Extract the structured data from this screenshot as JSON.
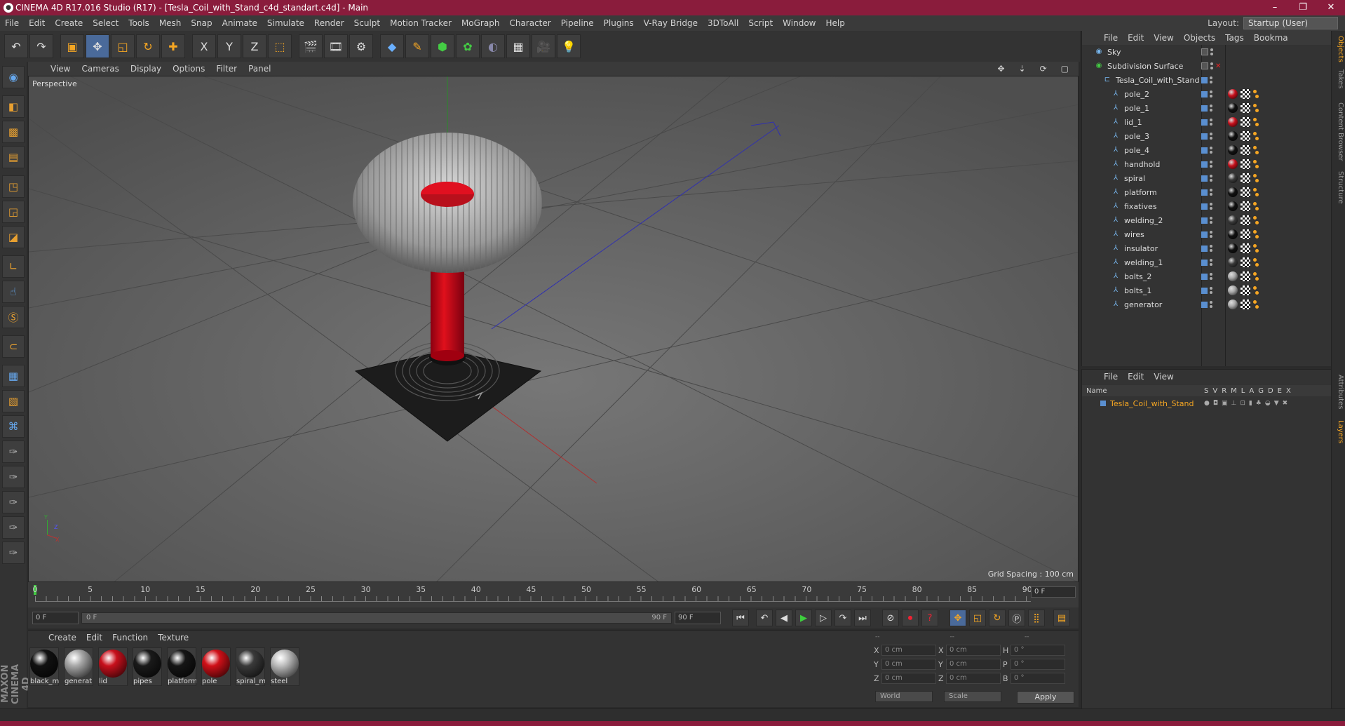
{
  "window": {
    "title": "CINEMA 4D R17.016 Studio (R17) - [Tesla_Coil_with_Stand_c4d_standart.c4d] - Main",
    "minimize": "–",
    "maximize": "❐",
    "close": "✕"
  },
  "menubar": [
    "File",
    "Edit",
    "Create",
    "Select",
    "Tools",
    "Mesh",
    "Snap",
    "Animate",
    "Simulate",
    "Render",
    "Sculpt",
    "Motion Tracker",
    "MoGraph",
    "Character",
    "Pipeline",
    "Plugins",
    "V-Ray Bridge",
    "3DToAll",
    "Script",
    "Window",
    "Help"
  ],
  "layout": {
    "label": "Layout:",
    "value": "Startup (User)"
  },
  "toolbar": {
    "undo_icon": "undo-icon",
    "x": "X",
    "y": "Y",
    "z": "Z"
  },
  "viewport": {
    "menu": [
      "View",
      "Cameras",
      "Display",
      "Options",
      "Filter",
      "Panel"
    ],
    "label": "Perspective",
    "grid_spacing": "Grid Spacing : 100 cm",
    "axis_x": "X",
    "axis_y": "Y",
    "axis_z": "Z"
  },
  "timeline": {
    "ticks": [
      "0",
      "5",
      "10",
      "15",
      "20",
      "25",
      "30",
      "35",
      "40",
      "45",
      "50",
      "55",
      "60",
      "65",
      "70",
      "75",
      "80",
      "85",
      "90"
    ],
    "current_frame": "0 F"
  },
  "transport": {
    "start": "0 F",
    "slider_left": "0 F",
    "slider_right": "90 F",
    "end": "90 F"
  },
  "materials": {
    "menu": [
      "Create",
      "Edit",
      "Function",
      "Texture"
    ],
    "items": [
      {
        "name": "black_m",
        "color": "#111111"
      },
      {
        "name": "generat",
        "color": "#a8a8a8"
      },
      {
        "name": "lid",
        "color": "#c8101c"
      },
      {
        "name": "pipes",
        "color": "#1a1a1a"
      },
      {
        "name": "platform",
        "color": "#151515"
      },
      {
        "name": "pole",
        "color": "#d01018"
      },
      {
        "name": "spiral_m",
        "color": "#3a3a3a"
      },
      {
        "name": "steel",
        "color": "#bdbdbd"
      }
    ]
  },
  "coords": {
    "header": [
      "--",
      "--",
      "--"
    ],
    "rows": [
      {
        "a": "X",
        "av": "0 cm",
        "b": "X",
        "bv": "0 cm",
        "c": "H",
        "cv": "0 °"
      },
      {
        "a": "Y",
        "av": "0 cm",
        "b": "Y",
        "bv": "0 cm",
        "c": "P",
        "cv": "0 °"
      },
      {
        "a": "Z",
        "av": "0 cm",
        "b": "Z",
        "bv": "0 cm",
        "c": "B",
        "cv": "0 °"
      }
    ],
    "world": "World",
    "scale": "Scale",
    "apply": "Apply"
  },
  "objects": {
    "menu": [
      "File",
      "Edit",
      "View",
      "Objects",
      "Tags",
      "Bookma"
    ],
    "items": [
      {
        "name": "Sky",
        "indent": 0,
        "tag": ""
      },
      {
        "name": "Subdivision Surface",
        "indent": 0,
        "tag": ""
      },
      {
        "name": "Tesla_Coil_with_Stand",
        "indent": 1,
        "tag": ""
      },
      {
        "name": "pole_2",
        "indent": 2,
        "tag": "#c8101c"
      },
      {
        "name": "pole_1",
        "indent": 2,
        "tag": "#111111"
      },
      {
        "name": "lid_1",
        "indent": 2,
        "tag": "#c8101c"
      },
      {
        "name": "pole_3",
        "indent": 2,
        "tag": "#111111"
      },
      {
        "name": "pole_4",
        "indent": 2,
        "tag": "#111111"
      },
      {
        "name": "handhold",
        "indent": 2,
        "tag": "#c8101c"
      },
      {
        "name": "spiral",
        "indent": 2,
        "tag": "#3a3a3a"
      },
      {
        "name": "platform",
        "indent": 2,
        "tag": "#111111"
      },
      {
        "name": "fixatives",
        "indent": 2,
        "tag": "#111111"
      },
      {
        "name": "welding_2",
        "indent": 2,
        "tag": "#3a3a3a"
      },
      {
        "name": "wires",
        "indent": 2,
        "tag": "#111111"
      },
      {
        "name": "insulator",
        "indent": 2,
        "tag": "#111111"
      },
      {
        "name": "welding_1",
        "indent": 2,
        "tag": "#3a3a3a"
      },
      {
        "name": "bolts_2",
        "indent": 2,
        "tag": "#a8a8a8"
      },
      {
        "name": "bolts_1",
        "indent": 2,
        "tag": "#a8a8a8"
      },
      {
        "name": "generator",
        "indent": 2,
        "tag": "#a8a8a8"
      }
    ]
  },
  "layers": {
    "menu": [
      "File",
      "Edit",
      "View"
    ],
    "name_header": "Name",
    "cols": [
      "S",
      "V",
      "R",
      "M",
      "L",
      "A",
      "G",
      "D",
      "E",
      "X"
    ],
    "row": "Tesla_Coil_with_Stand"
  },
  "sidetabs": [
    "Objects",
    "Takes",
    "Content Browser",
    "Structure",
    "Attributes",
    "Layers"
  ]
}
